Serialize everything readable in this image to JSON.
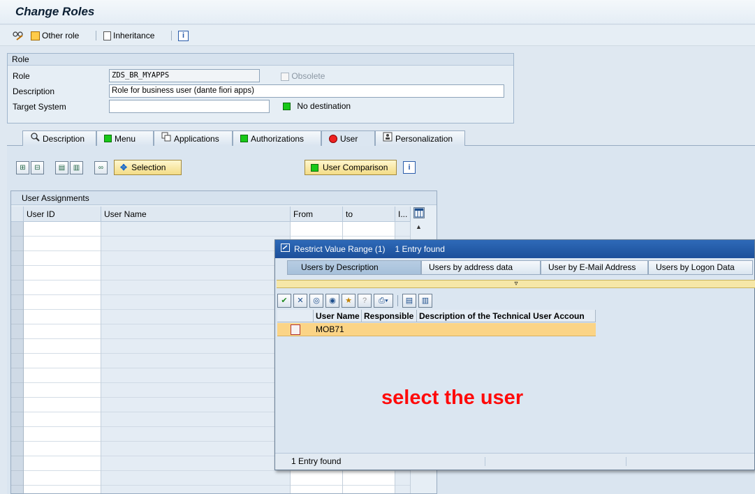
{
  "title": "Change Roles",
  "toolbar": {
    "other_role": "Other role",
    "inheritance": "Inheritance",
    "info": "i"
  },
  "role_group": {
    "title": "Role",
    "role_label": "Role",
    "role_value": "ZDS_BR_MYAPPS",
    "obsolete_label": "Obsolete",
    "description_label": "Description",
    "description_value": "Role for business user (dante fiori apps)",
    "target_system_label": "Target System",
    "target_system_value": "",
    "destination_status": "No destination"
  },
  "tabs": [
    {
      "label": "Description"
    },
    {
      "label": "Menu"
    },
    {
      "label": "Applications"
    },
    {
      "label": "Authorizations"
    },
    {
      "label": "User"
    },
    {
      "label": "Personalization"
    }
  ],
  "user_tab": {
    "selection_button": "Selection",
    "user_comparison_button": "User Comparison"
  },
  "user_assignments": {
    "title": "User Assignments",
    "columns": [
      "User ID",
      "User Name",
      "From",
      "to",
      "I..."
    ]
  },
  "popup": {
    "title": "Restrict Value Range (1)",
    "entries_found": "1 Entry found",
    "tabs": [
      "Users by Description",
      "Users by address data",
      "User by E-Mail Address",
      "Users by Logon Data"
    ],
    "columns": [
      "User Name",
      "Responsible",
      "Description of the Technical User Accoun"
    ],
    "rows": [
      {
        "user_name": "MOB71",
        "responsible": "",
        "description": ""
      }
    ],
    "status": "1 Entry found"
  },
  "annotation": "select the user",
  "colors": {
    "title_bar": "#1c4f9a",
    "selected_row": "#fbd486",
    "annotation": "#ff0a0a",
    "led_green": "#18c818",
    "led_red": "#ee2222"
  }
}
